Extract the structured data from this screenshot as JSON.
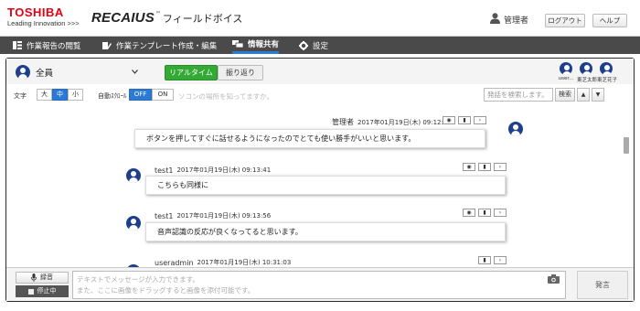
{
  "header": {
    "brand": "TOSHIBA",
    "brand_tagline": "Leading Innovation >>>",
    "product": "RECAIUS",
    "product_tm": "™",
    "product_sub": "フィールドボイス",
    "user_name": "管理者",
    "logout_label": "ログアウト",
    "help_label": "ヘルプ"
  },
  "nav": {
    "items": [
      {
        "label": "作業報告の閲覧"
      },
      {
        "label": "作業テンプレート作成・編集"
      },
      {
        "label": "情報共有"
      },
      {
        "label": "設定"
      }
    ],
    "active_color": "#2a7ad6"
  },
  "channel": {
    "name": "全員",
    "realtime_label": "リアルタイム",
    "history_label": "振り返り"
  },
  "members": [
    {
      "name": "user..."
    },
    {
      "name": "東芝太郎"
    },
    {
      "name": "東芝花子"
    }
  ],
  "toolbar": {
    "text_label": "文字",
    "size_large": "大",
    "size_medium": "中",
    "size_small": "小",
    "autoscroll_label": "自動ｽｸﾛｰﾙ",
    "off_label": "OFF",
    "on_label": "ON",
    "search_placeholder": "発話を検索します。",
    "search_button": "検索",
    "up_arrow": "▲",
    "down_arrow": "▼"
  },
  "faded_text": "ソコンの場所を知ってますか。",
  "messages": [
    {
      "name": "管理者",
      "time": "2017年01月19日(木) 09:12:58",
      "text": "ボタンを押してすぐに話せるようになったのでとても使い勝手がいいと思います。"
    },
    {
      "name": "test1",
      "time": "2017年01月19日(木) 09:13:41",
      "text": "こちらも同様に"
    },
    {
      "name": "test1",
      "time": "2017年01月19日(木) 09:13:56",
      "text": "音声認識の反応が良くなってると思います。"
    },
    {
      "name": "useradmin",
      "time": "2017年01月19日(木) 10:31:03",
      "text": ""
    }
  ],
  "input": {
    "rec_label": "録音",
    "stop_label": "停止中",
    "placeholder_line1": "テキストでメッセージが入力できます。",
    "placeholder_line2": "また、ここに画像をドラッグすると画像を添付可能です。",
    "send_label": "発言"
  },
  "colors": {
    "brand_red": "#e60012",
    "realtime_green": "#35a935",
    "avatar_blue": "#1f3f8c",
    "nav_bg": "#4a4a4a"
  }
}
